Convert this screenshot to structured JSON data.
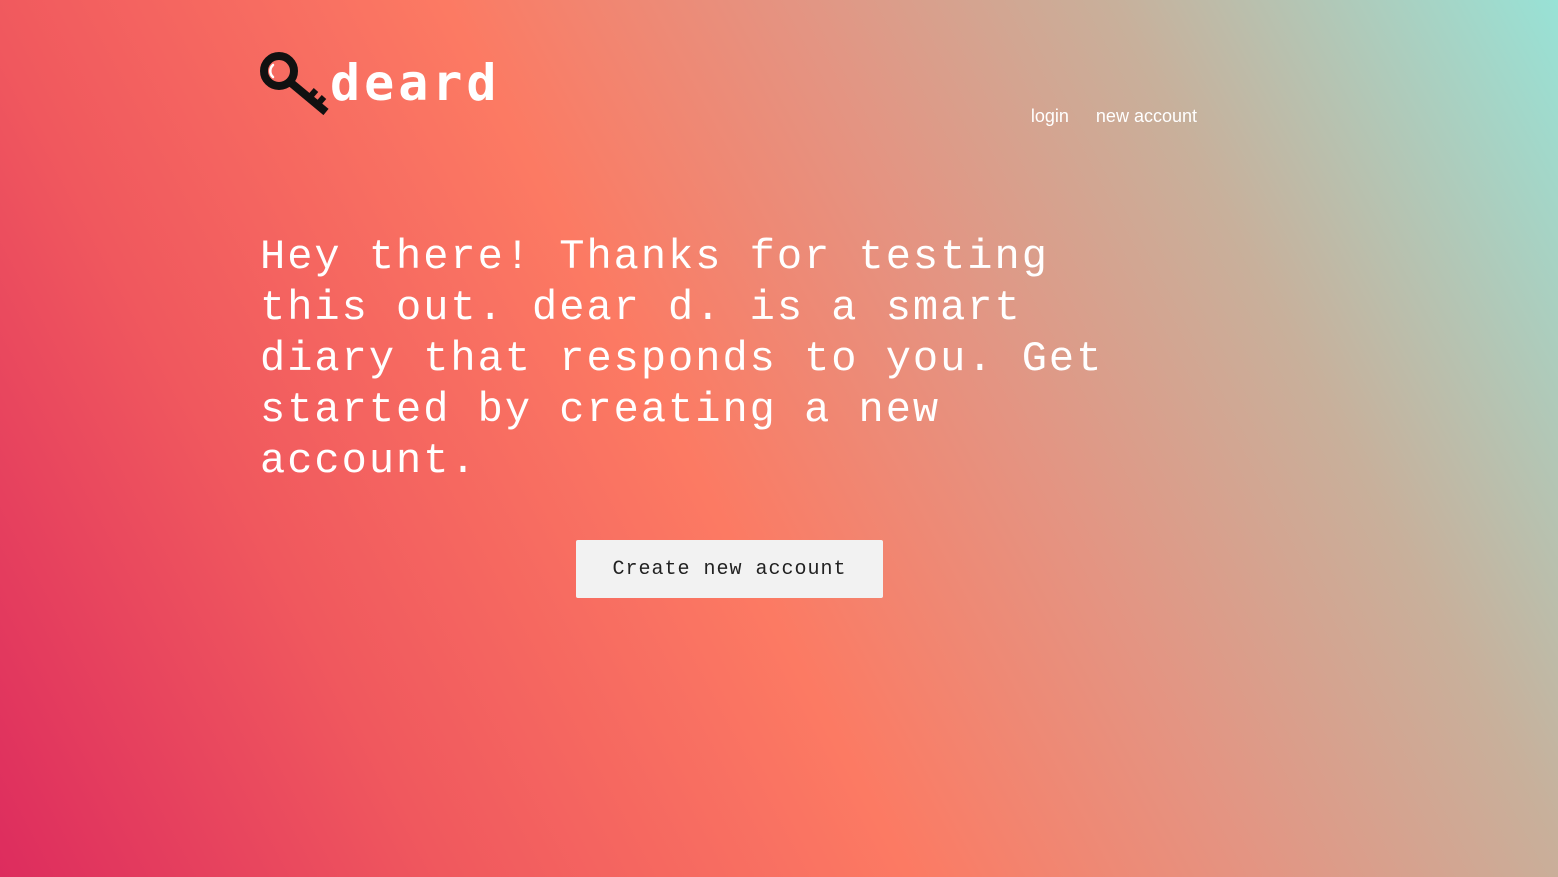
{
  "brand": {
    "icon": "key-icon",
    "name": "deard",
    "colors": {
      "text": "#ffffff",
      "icon": "#111111"
    }
  },
  "nav": {
    "login_label": "login",
    "new_account_label": "new account"
  },
  "hero": {
    "text": "Hey there! Thanks for testing this out. dear d. is a smart diary that responds to you. Get started by creating a new account."
  },
  "cta": {
    "label": "Create new account",
    "background": "#f2f2f2"
  },
  "background": {
    "gradient": [
      "#dd2c5e",
      "#fc7a63",
      "#98e2d6"
    ]
  }
}
